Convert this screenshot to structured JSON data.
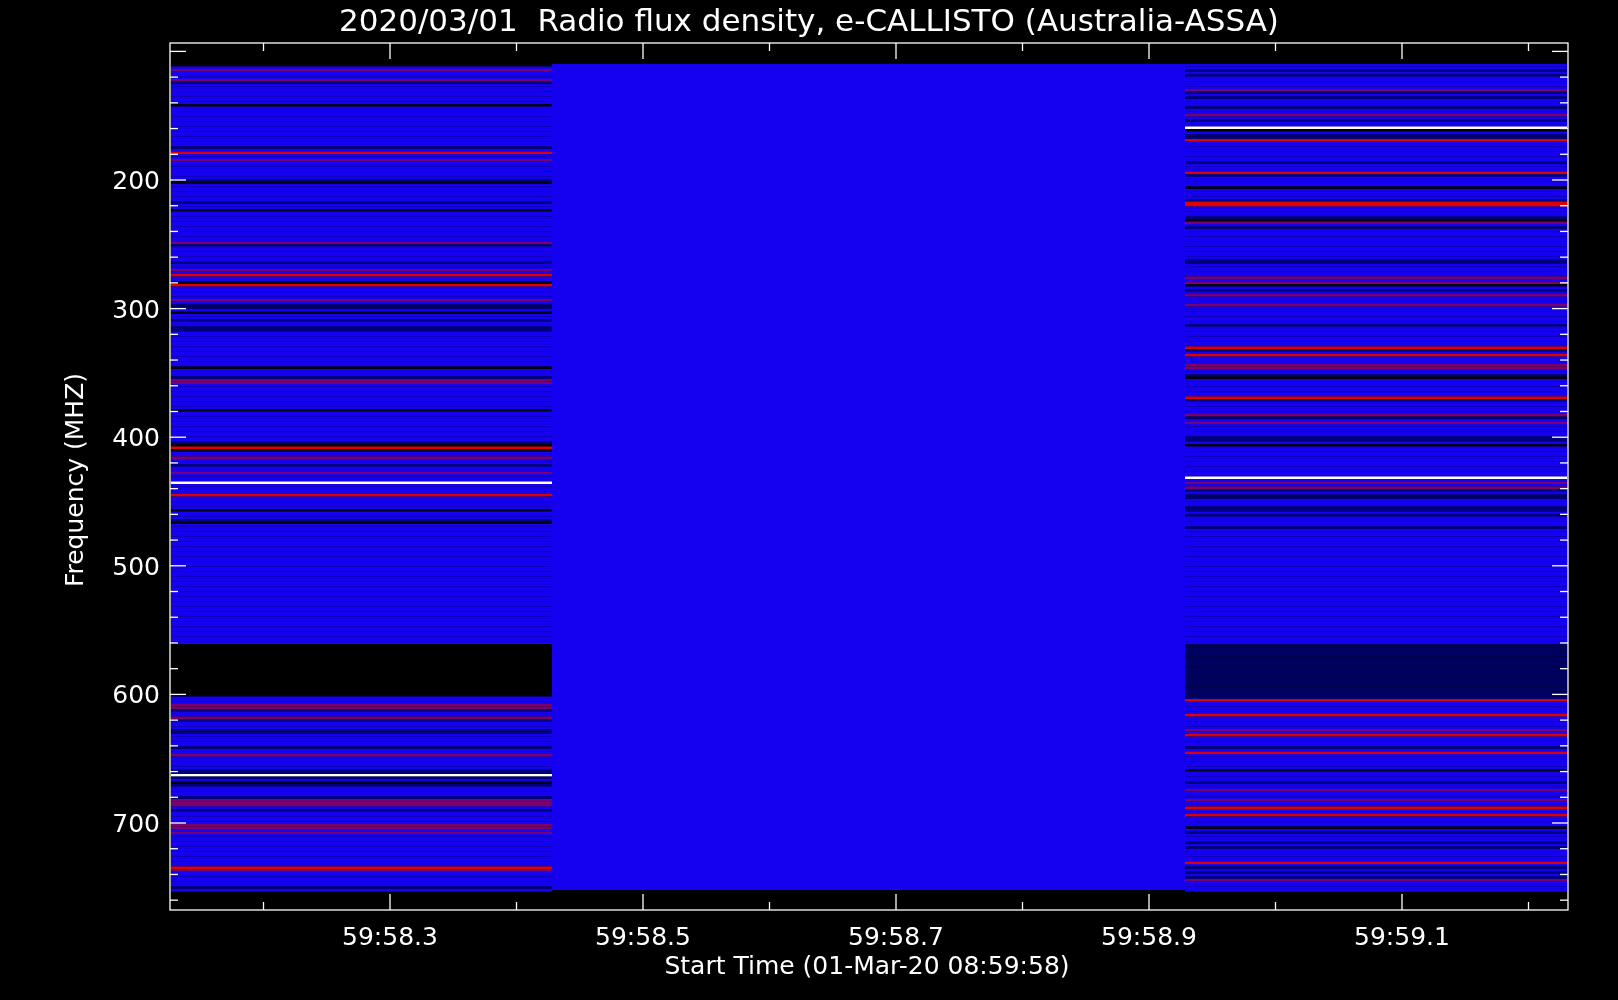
{
  "title": "2020/03/01  Radio flux density, e-CALLISTO (Australia-ASSA)",
  "y_axis": {
    "label": "Frequency (MHZ)",
    "ticks": [
      "200",
      "300",
      "400",
      "500",
      "600",
      "700"
    ]
  },
  "x_axis": {
    "label": "Start Time (01-Mar-20 08:59:58)",
    "ticks": [
      "59:58.3",
      "59:58.5",
      "59:58.7",
      "59:58.9",
      "59:59.1"
    ]
  }
}
